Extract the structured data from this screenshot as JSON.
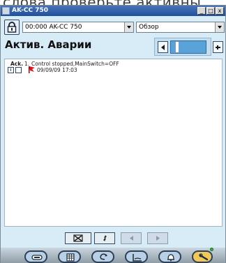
{
  "caption": "слова проверьте активны",
  "window": {
    "title": "AK-CC 750",
    "title_buttons": [
      "_",
      "□",
      "x"
    ]
  },
  "toolbar": {
    "device_select": "00:000 AK-CC 750",
    "view_select": "Обзор"
  },
  "page": {
    "title": "Актив. Аварии"
  },
  "alarm": {
    "ack_label": "Ack.",
    "number": "1.",
    "message": "Control stopped,MainSwitch=OFF",
    "timestamp": "09/09/09 17:03",
    "info_icon_text": "i"
  },
  "colors": {
    "window_bg": "#d7ecf7",
    "titlebar": "#1f4f9d",
    "alarm_flag": "#e1141e",
    "slider": "#5aa3d8",
    "status_led": "#2fb33a"
  },
  "bottom_nav": {
    "icons": [
      "clear-icon",
      "refresh-icon",
      "arrow-left-icon",
      "arrow-right-icon"
    ]
  },
  "dock": {
    "icons": [
      "controller-icon",
      "grid-icon",
      "recycle-icon",
      "chart-icon",
      "bell-icon",
      "wrench-icon"
    ]
  }
}
